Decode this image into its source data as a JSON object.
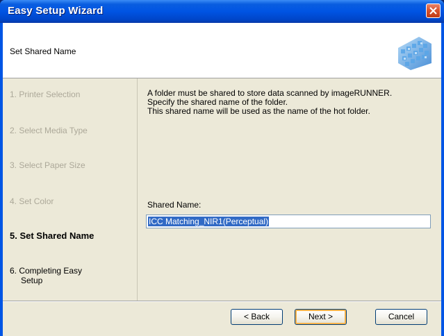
{
  "window": {
    "title": "Easy Setup Wizard"
  },
  "header": {
    "title": "Set Shared Name"
  },
  "steps": [
    {
      "label": "1.  Printer Selection",
      "state": "done"
    },
    {
      "label": "2.  Select Media Type",
      "state": "done"
    },
    {
      "label": "3.  Select Paper Size",
      "state": "done"
    },
    {
      "label": "4.  Set Color",
      "state": "done"
    },
    {
      "label": "5.  Set Shared Name",
      "state": "current"
    },
    {
      "label": "6.  Completing Easy Setup",
      "label_line1": "6.  Completing Easy",
      "label_line2": "Setup",
      "state": "upcoming"
    }
  ],
  "content": {
    "description_line1": "A folder must be shared to store data scanned by imageRUNNER.",
    "description_line2": "Specify the shared name of the folder.",
    "description_line3": "This shared name will be used as the name of the hot folder.",
    "shared_name_label": "Shared Name:",
    "shared_name_value": "ICC Matching_NIR1(Perceptual)"
  },
  "buttons": {
    "back": "< Back",
    "next": "Next >",
    "cancel": "Cancel"
  },
  "icons": {
    "close": "close-icon",
    "logo": "wizard-logo-icon"
  },
  "colors": {
    "titlebar": "#0054e3",
    "selection": "#316ac5",
    "disabled_text": "#aca899"
  }
}
